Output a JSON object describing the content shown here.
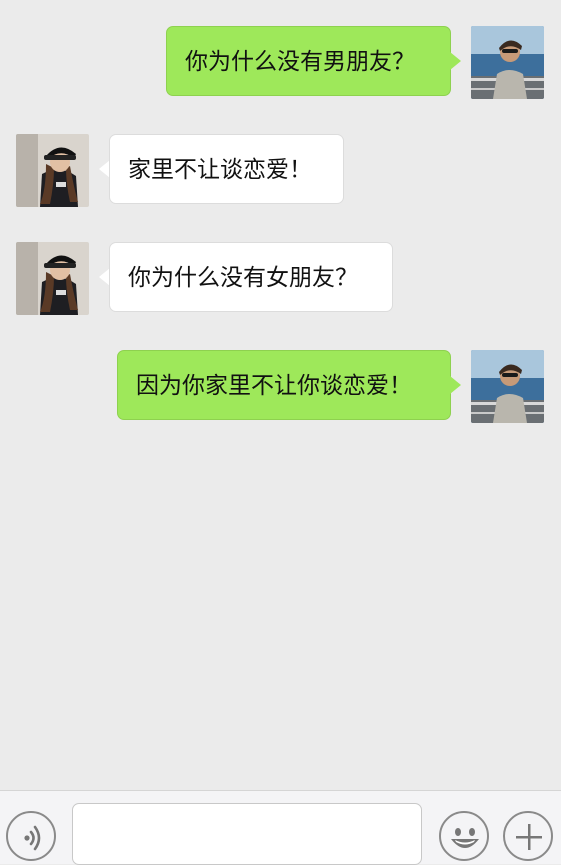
{
  "messages": [
    {
      "direction": "outgoing",
      "sender": "me",
      "text": "你为什么没有男朋友？"
    },
    {
      "direction": "incoming",
      "sender": "her",
      "text": "家里不让谈恋爱！"
    },
    {
      "direction": "incoming",
      "sender": "her",
      "text": "你为什么没有女朋友？"
    },
    {
      "direction": "outgoing",
      "sender": "me",
      "text": "因为你家里不让你谈恋爱！"
    }
  ],
  "input": {
    "value": "",
    "placeholder": ""
  },
  "toolbar": {
    "voice_icon": "voice-icon",
    "emoji_icon": "emoji-icon",
    "plus_icon": "plus-icon"
  },
  "colors": {
    "background": "#ebebeb",
    "outgoing_bubble": "#9ee85a",
    "incoming_bubble": "#ffffff",
    "toolbar": "#f4f4f6"
  }
}
